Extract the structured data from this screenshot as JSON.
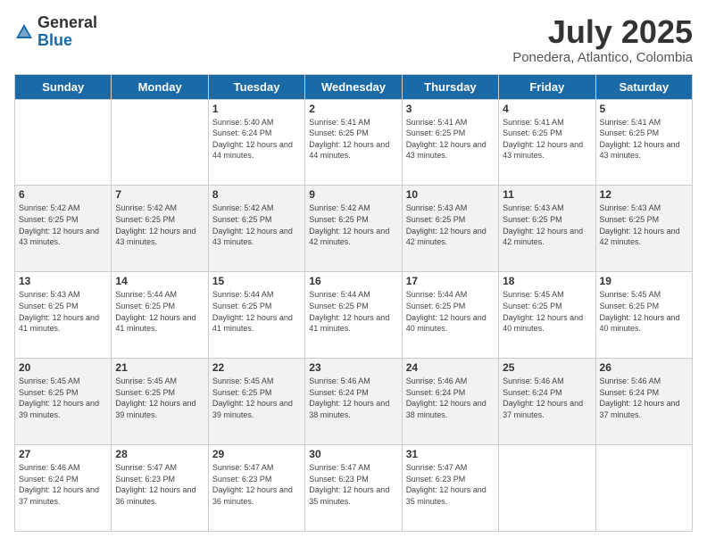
{
  "header": {
    "logo_general": "General",
    "logo_blue": "Blue",
    "month_title": "July 2025",
    "location": "Ponedera, Atlantico, Colombia"
  },
  "days_of_week": [
    "Sunday",
    "Monday",
    "Tuesday",
    "Wednesday",
    "Thursday",
    "Friday",
    "Saturday"
  ],
  "weeks": [
    [
      {
        "day": "",
        "info": ""
      },
      {
        "day": "",
        "info": ""
      },
      {
        "day": "1",
        "info": "Sunrise: 5:40 AM\nSunset: 6:24 PM\nDaylight: 12 hours and 44 minutes."
      },
      {
        "day": "2",
        "info": "Sunrise: 5:41 AM\nSunset: 6:25 PM\nDaylight: 12 hours and 44 minutes."
      },
      {
        "day": "3",
        "info": "Sunrise: 5:41 AM\nSunset: 6:25 PM\nDaylight: 12 hours and 43 minutes."
      },
      {
        "day": "4",
        "info": "Sunrise: 5:41 AM\nSunset: 6:25 PM\nDaylight: 12 hours and 43 minutes."
      },
      {
        "day": "5",
        "info": "Sunrise: 5:41 AM\nSunset: 6:25 PM\nDaylight: 12 hours and 43 minutes."
      }
    ],
    [
      {
        "day": "6",
        "info": "Sunrise: 5:42 AM\nSunset: 6:25 PM\nDaylight: 12 hours and 43 minutes."
      },
      {
        "day": "7",
        "info": "Sunrise: 5:42 AM\nSunset: 6:25 PM\nDaylight: 12 hours and 43 minutes."
      },
      {
        "day": "8",
        "info": "Sunrise: 5:42 AM\nSunset: 6:25 PM\nDaylight: 12 hours and 43 minutes."
      },
      {
        "day": "9",
        "info": "Sunrise: 5:42 AM\nSunset: 6:25 PM\nDaylight: 12 hours and 42 minutes."
      },
      {
        "day": "10",
        "info": "Sunrise: 5:43 AM\nSunset: 6:25 PM\nDaylight: 12 hours and 42 minutes."
      },
      {
        "day": "11",
        "info": "Sunrise: 5:43 AM\nSunset: 6:25 PM\nDaylight: 12 hours and 42 minutes."
      },
      {
        "day": "12",
        "info": "Sunrise: 5:43 AM\nSunset: 6:25 PM\nDaylight: 12 hours and 42 minutes."
      }
    ],
    [
      {
        "day": "13",
        "info": "Sunrise: 5:43 AM\nSunset: 6:25 PM\nDaylight: 12 hours and 41 minutes."
      },
      {
        "day": "14",
        "info": "Sunrise: 5:44 AM\nSunset: 6:25 PM\nDaylight: 12 hours and 41 minutes."
      },
      {
        "day": "15",
        "info": "Sunrise: 5:44 AM\nSunset: 6:25 PM\nDaylight: 12 hours and 41 minutes."
      },
      {
        "day": "16",
        "info": "Sunrise: 5:44 AM\nSunset: 6:25 PM\nDaylight: 12 hours and 41 minutes."
      },
      {
        "day": "17",
        "info": "Sunrise: 5:44 AM\nSunset: 6:25 PM\nDaylight: 12 hours and 40 minutes."
      },
      {
        "day": "18",
        "info": "Sunrise: 5:45 AM\nSunset: 6:25 PM\nDaylight: 12 hours and 40 minutes."
      },
      {
        "day": "19",
        "info": "Sunrise: 5:45 AM\nSunset: 6:25 PM\nDaylight: 12 hours and 40 minutes."
      }
    ],
    [
      {
        "day": "20",
        "info": "Sunrise: 5:45 AM\nSunset: 6:25 PM\nDaylight: 12 hours and 39 minutes."
      },
      {
        "day": "21",
        "info": "Sunrise: 5:45 AM\nSunset: 6:25 PM\nDaylight: 12 hours and 39 minutes."
      },
      {
        "day": "22",
        "info": "Sunrise: 5:45 AM\nSunset: 6:25 PM\nDaylight: 12 hours and 39 minutes."
      },
      {
        "day": "23",
        "info": "Sunrise: 5:46 AM\nSunset: 6:24 PM\nDaylight: 12 hours and 38 minutes."
      },
      {
        "day": "24",
        "info": "Sunrise: 5:46 AM\nSunset: 6:24 PM\nDaylight: 12 hours and 38 minutes."
      },
      {
        "day": "25",
        "info": "Sunrise: 5:46 AM\nSunset: 6:24 PM\nDaylight: 12 hours and 37 minutes."
      },
      {
        "day": "26",
        "info": "Sunrise: 5:46 AM\nSunset: 6:24 PM\nDaylight: 12 hours and 37 minutes."
      }
    ],
    [
      {
        "day": "27",
        "info": "Sunrise: 5:46 AM\nSunset: 6:24 PM\nDaylight: 12 hours and 37 minutes."
      },
      {
        "day": "28",
        "info": "Sunrise: 5:47 AM\nSunset: 6:23 PM\nDaylight: 12 hours and 36 minutes."
      },
      {
        "day": "29",
        "info": "Sunrise: 5:47 AM\nSunset: 6:23 PM\nDaylight: 12 hours and 36 minutes."
      },
      {
        "day": "30",
        "info": "Sunrise: 5:47 AM\nSunset: 6:23 PM\nDaylight: 12 hours and 35 minutes."
      },
      {
        "day": "31",
        "info": "Sunrise: 5:47 AM\nSunset: 6:23 PM\nDaylight: 12 hours and 35 minutes."
      },
      {
        "day": "",
        "info": ""
      },
      {
        "day": "",
        "info": ""
      }
    ]
  ]
}
